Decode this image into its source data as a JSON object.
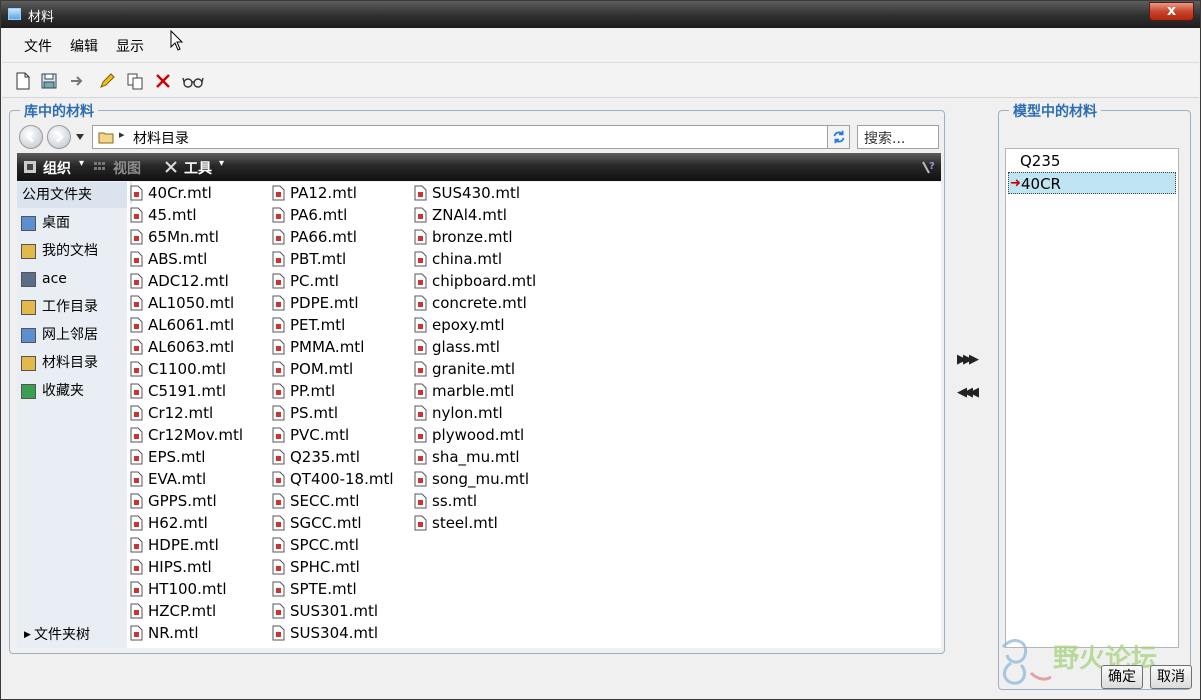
{
  "window": {
    "title": "材料",
    "close": "x"
  },
  "menu": [
    "文件",
    "编辑",
    "显示"
  ],
  "toolbar_icons": [
    "new-icon",
    "save-icon",
    "arrow-icon",
    "edit-icon",
    "copy-icon",
    "delete-icon",
    "glasses-icon"
  ],
  "library": {
    "group_title": "库中的材料",
    "address": {
      "path": "材料目录",
      "search_placeholder": "搜索..."
    },
    "dark_toolbar": {
      "organize": "组织",
      "views": "视图",
      "tools": "工具"
    },
    "sidebar": {
      "items": [
        {
          "label": "公用文件夹",
          "icon": ""
        },
        {
          "label": "桌面",
          "icon": "desktop-icon"
        },
        {
          "label": "我的文档",
          "icon": "documents-icon"
        },
        {
          "label": "ace",
          "icon": "user-icon"
        },
        {
          "label": "工作目录",
          "icon": "workdir-icon"
        },
        {
          "label": "网上邻居",
          "icon": "network-icon"
        },
        {
          "label": "材料目录",
          "icon": "folder-icon"
        },
        {
          "label": "收藏夹",
          "icon": "favorites-icon"
        }
      ],
      "tree_toggle": "文件夹树"
    },
    "files": [
      [
        "40Cr.mtl",
        "45.mtl",
        "65Mn.mtl",
        "ABS.mtl",
        "ADC12.mtl",
        "AL1050.mtl",
        "AL6061.mtl",
        "AL6063.mtl",
        "C1100.mtl",
        "C5191.mtl",
        "Cr12.mtl",
        "Cr12Mov.mtl",
        "EPS.mtl",
        "EVA.mtl",
        "GPPS.mtl",
        "H62.mtl",
        "HDPE.mtl",
        "HIPS.mtl",
        "HT100.mtl",
        "HZCP.mtl",
        "NR.mtl"
      ],
      [
        "PA12.mtl",
        "PA6.mtl",
        "PA66.mtl",
        "PBT.mtl",
        "PC.mtl",
        "PDPE.mtl",
        "PET.mtl",
        "PMMA.mtl",
        "POM.mtl",
        "PP.mtl",
        "PS.mtl",
        "PVC.mtl",
        "Q235.mtl",
        "QT400-18.mtl",
        "SECC.mtl",
        "SGCC.mtl",
        "SPCC.mtl",
        "SPHC.mtl",
        "SPTE.mtl",
        "SUS301.mtl",
        "SUS304.mtl"
      ],
      [
        "SUS430.mtl",
        "ZNAl4.mtl",
        "bronze.mtl",
        "china.mtl",
        "chipboard.mtl",
        "concrete.mtl",
        "epoxy.mtl",
        "glass.mtl",
        "granite.mtl",
        "marble.mtl",
        "nylon.mtl",
        "plywood.mtl",
        "sha_mu.mtl",
        "song_mu.mtl",
        "ss.mtl",
        "steel.mtl"
      ]
    ],
    "selected_file": "40Cr.mtl"
  },
  "transfer": {
    "add": "▶▶▶",
    "remove": "◀◀◀"
  },
  "model": {
    "group_title": "模型中的材料",
    "items": [
      "Q235",
      "40CR"
    ],
    "selected": "40CR"
  },
  "buttons": {
    "ok": "确定",
    "cancel": "取消"
  },
  "watermark": {
    "text": "野火论坛"
  },
  "colors": {
    "accent": "#2d6fb0",
    "selection": "#bfe4f2",
    "titlebar": "#2f2f2f"
  }
}
